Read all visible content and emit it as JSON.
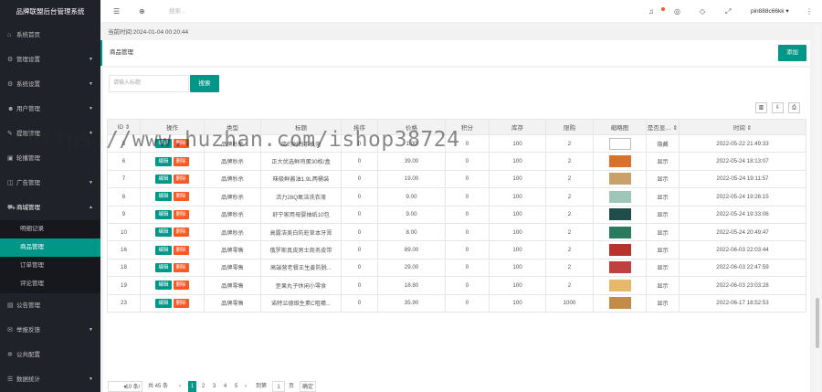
{
  "app_title": "品牌联盟后台管理系统",
  "sidebar": {
    "items": [
      {
        "icon": "home-icon",
        "glyph": "⌂",
        "label": "系统首页",
        "has_arrow": false
      },
      {
        "icon": "gear-icon",
        "glyph": "⚙",
        "label": "管理设置",
        "has_arrow": true
      },
      {
        "icon": "gear-icon",
        "glyph": "⚙",
        "label": "系统设置",
        "has_arrow": true
      },
      {
        "icon": "users-icon",
        "glyph": "☻",
        "label": "用户管理",
        "has_arrow": true
      },
      {
        "icon": "edit-icon",
        "glyph": "✎",
        "label": "提现管理",
        "has_arrow": true
      },
      {
        "icon": "image-icon",
        "glyph": "▣",
        "label": "轮播管理",
        "has_arrow": false
      },
      {
        "icon": "ad-icon",
        "glyph": "◫",
        "label": "广告管理",
        "has_arrow": true
      },
      {
        "icon": "cart-icon",
        "glyph": "⛟",
        "label": "商城管理",
        "has_arrow": true,
        "open": true
      },
      {
        "icon": "notice-icon",
        "glyph": "▤",
        "label": "公告管理",
        "has_arrow": false
      },
      {
        "icon": "feedback-icon",
        "glyph": "✉",
        "label": "举报反馈",
        "has_arrow": true
      },
      {
        "icon": "config-icon",
        "glyph": "✲",
        "label": "公共配置",
        "has_arrow": false
      },
      {
        "icon": "info-icon",
        "glyph": "☰",
        "label": "数据统计",
        "has_arrow": true
      }
    ],
    "sub_items": [
      {
        "label": "明细记录",
        "active": false
      },
      {
        "label": "商品管理",
        "active": true
      },
      {
        "label": "订单管理",
        "active": false
      },
      {
        "label": "评论管理",
        "active": false
      }
    ]
  },
  "header": {
    "search_placeholder": "搜索...",
    "username": "pin888c66kk"
  },
  "current_time": "当前时间:2024-01-04 00:20:44",
  "page_title": "商品管理",
  "add_button": "添加",
  "search": {
    "placeholder": "请输入标题",
    "button": "搜索"
  },
  "table": {
    "headers": [
      "ID",
      "操作",
      "类型",
      "标题",
      "排序",
      "价格",
      "积分",
      "库存",
      "限购",
      "缩略图",
      "是否显…",
      "时间"
    ],
    "edit_label": "编辑",
    "delete_label": "删除",
    "rows": [
      {
        "id": "5",
        "type": "品牌秒杀",
        "title": "简约时尚手机壳",
        "sort": "0",
        "price": "1.00",
        "points": "0",
        "stock": "100",
        "limit": "2",
        "thumb": "#ffffff",
        "show": "隐藏",
        "time": "2022-05-22 21:49:33"
      },
      {
        "id": "6",
        "type": "品牌秒杀",
        "title": "正大优选鲜鸡蛋30枚/盒",
        "sort": "0",
        "price": "39.00",
        "points": "0",
        "stock": "100",
        "limit": "2",
        "thumb": "#d9702b",
        "show": "显示",
        "time": "2022-05-24 18:13:07"
      },
      {
        "id": "7",
        "type": "品牌秒杀",
        "title": "味极鲜酱油1.9L两桶装",
        "sort": "0",
        "price": "19.00",
        "points": "0",
        "stock": "100",
        "limit": "2",
        "thumb": "#c9a06a",
        "show": "显示",
        "time": "2022-05-24 19:11:57"
      },
      {
        "id": "8",
        "type": "品牌秒杀",
        "title": "活力28Q氧洁洗衣液",
        "sort": "0",
        "price": "9.00",
        "points": "0",
        "stock": "100",
        "limit": "2",
        "thumb": "#9fc5b8",
        "show": "显示",
        "time": "2022-05-24 19:26:15"
      },
      {
        "id": "9",
        "type": "品牌秒杀",
        "title": "舒宁家用母婴抽纸10包",
        "sort": "0",
        "price": "9.00",
        "points": "0",
        "stock": "100",
        "limit": "2",
        "thumb": "#1f4e4a",
        "show": "显示",
        "time": "2022-05-24 19:33:06"
      },
      {
        "id": "10",
        "type": "品牌秒杀",
        "title": "高露洁美白防蛀草本牙膏",
        "sort": "0",
        "price": "8.00",
        "points": "0",
        "stock": "100",
        "limit": "2",
        "thumb": "#2a7a5e",
        "show": "显示",
        "time": "2022-05-24 20:49:47"
      },
      {
        "id": "16",
        "type": "品牌零售",
        "title": "俄罗斯真皮男士商务皮带",
        "sort": "0",
        "price": "89.00",
        "points": "0",
        "stock": "100",
        "limit": "2",
        "thumb": "#b8332c",
        "show": "显示",
        "time": "2022-06-03 22:03:44"
      },
      {
        "id": "18",
        "type": "品牌零售",
        "title": "高端营老餐王生姜防脱...",
        "sort": "0",
        "price": "29.00",
        "points": "0",
        "stock": "100",
        "limit": "2",
        "thumb": "#c04040",
        "show": "显示",
        "time": "2022-06-03 22:47:59"
      },
      {
        "id": "19",
        "type": "品牌零售",
        "title": "歪果丸子休闲小零食",
        "sort": "0",
        "price": "18.80",
        "points": "0",
        "stock": "100",
        "limit": "2",
        "thumb": "#e8b86a",
        "show": "显示",
        "time": "2022-06-03 23:03:28"
      },
      {
        "id": "23",
        "type": "品牌零售",
        "title": "诺特兰德维生素C咀嚼...",
        "sort": "0",
        "price": "35.90",
        "points": "0",
        "stock": "100",
        "limit": "1000",
        "thumb": "#c48a4a",
        "show": "显示",
        "time": "2022-06-17 18:52:53"
      }
    ]
  },
  "pager": {
    "page_size": "10 条/页",
    "total": "共 45 条",
    "pages": [
      "1",
      "2",
      "3",
      "4",
      "5"
    ],
    "current": "1",
    "goto_label": "到第",
    "goto_value": "1",
    "page_unit": "页",
    "confirm": "确定"
  },
  "watermark": "https://www.huzhan.com/ishop38724"
}
